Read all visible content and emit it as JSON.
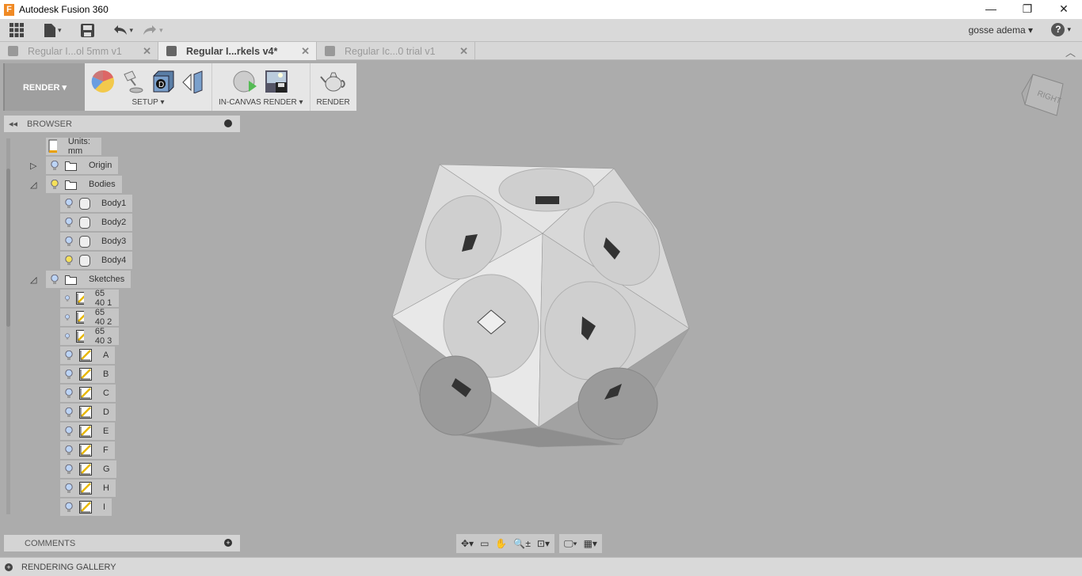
{
  "app": {
    "title": "Autodesk Fusion 360",
    "logo_letter": "F"
  },
  "window_controls": [
    "minimize",
    "restore",
    "close"
  ],
  "user": {
    "name": "gosse adema ▾"
  },
  "tabs": [
    {
      "label": "Regular I...ol 5mm v1",
      "active": false
    },
    {
      "label": "Regular I...rkels v4*",
      "active": true
    },
    {
      "label": "Regular Ic...0 trial v1",
      "active": false
    }
  ],
  "toolbar": {
    "workspace": "RENDER ▾",
    "groups": [
      {
        "label": "SETUP ▾",
        "icons": [
          "appearance-icon",
          "scene-settings-icon",
          "texture-map-icon",
          "decal-icon"
        ]
      },
      {
        "label": "IN-CANVAS RENDER ▾",
        "icons": [
          "in-canvas-render-icon",
          "capture-image-icon"
        ]
      },
      {
        "label": "RENDER",
        "icons": [
          "render-teapot-icon"
        ]
      }
    ]
  },
  "viewcube": {
    "face": "RIGHT"
  },
  "browser": {
    "title": "BROWSER",
    "items": [
      {
        "label": "Units: mm",
        "level": 0,
        "type": "units",
        "expander": "",
        "bulb": ""
      },
      {
        "label": "Origin",
        "level": 0,
        "type": "folder",
        "expander": "collapsed",
        "bulb": "off"
      },
      {
        "label": "Bodies",
        "level": 0,
        "type": "folder",
        "expander": "expanded",
        "bulb": "on"
      },
      {
        "label": "Body1",
        "level": 1,
        "type": "body",
        "expander": "",
        "bulb": "off"
      },
      {
        "label": "Body2",
        "level": 1,
        "type": "body",
        "expander": "",
        "bulb": "off"
      },
      {
        "label": "Body3",
        "level": 1,
        "type": "body",
        "expander": "",
        "bulb": "off"
      },
      {
        "label": "Body4",
        "level": 1,
        "type": "body",
        "expander": "",
        "bulb": "on"
      },
      {
        "label": "Sketches",
        "level": 0,
        "type": "folder",
        "expander": "expanded",
        "bulb": "off"
      },
      {
        "label": "65 40 1",
        "level": 1,
        "type": "sketch",
        "expander": "",
        "bulb": "off"
      },
      {
        "label": "65 40 2",
        "level": 1,
        "type": "sketch",
        "expander": "",
        "bulb": "off"
      },
      {
        "label": "65 40 3",
        "level": 1,
        "type": "sketch",
        "expander": "",
        "bulb": "off"
      },
      {
        "label": "A",
        "level": 1,
        "type": "sketch",
        "expander": "",
        "bulb": "off"
      },
      {
        "label": "B",
        "level": 1,
        "type": "sketch",
        "expander": "",
        "bulb": "off"
      },
      {
        "label": "C",
        "level": 1,
        "type": "sketch",
        "expander": "",
        "bulb": "off"
      },
      {
        "label": "D",
        "level": 1,
        "type": "sketch",
        "expander": "",
        "bulb": "off"
      },
      {
        "label": "E",
        "level": 1,
        "type": "sketch",
        "expander": "",
        "bulb": "off"
      },
      {
        "label": "F",
        "level": 1,
        "type": "sketch",
        "expander": "",
        "bulb": "off"
      },
      {
        "label": "G",
        "level": 1,
        "type": "sketch",
        "expander": "",
        "bulb": "off"
      },
      {
        "label": "H",
        "level": 1,
        "type": "sketch",
        "expander": "",
        "bulb": "off"
      },
      {
        "label": "I",
        "level": 1,
        "type": "sketch",
        "expander": "",
        "bulb": "off"
      }
    ]
  },
  "comments": {
    "title": "COMMENTS"
  },
  "gallery": {
    "title": "RENDERING GALLERY"
  },
  "navbar": [
    "orbit-icon",
    "look-at-icon",
    "pan-icon",
    "zoom-icon",
    "fit-icon",
    "display-settings-icon",
    "grid-icon"
  ],
  "colors": {
    "canvas": "#acacac",
    "bulb_on": "#f5e05a",
    "bulb_off": "#bcd4f5",
    "accent": "#f08a24"
  }
}
